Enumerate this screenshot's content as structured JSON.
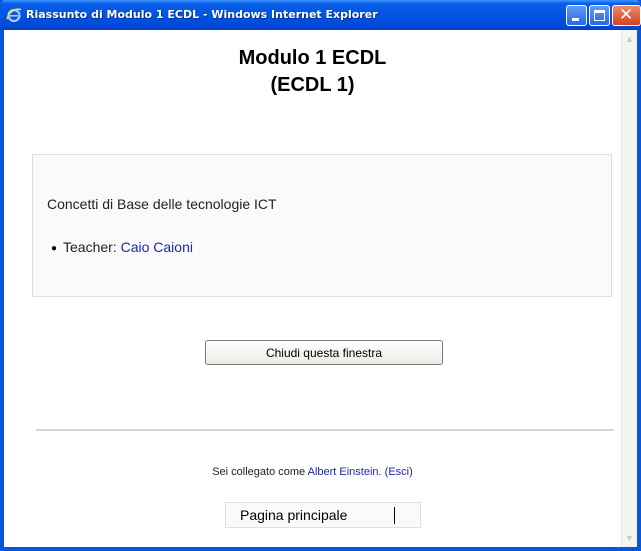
{
  "window": {
    "title": "Riassunto di Modulo 1 ECDL - Windows Internet Explorer",
    "accent": "#0055e5",
    "close_color": "#d6401c"
  },
  "course": {
    "title_line1": "Modulo 1 ECDL",
    "title_line2": "(ECDL 1)",
    "summary": "Concetti di Base delle tecnologie ICT",
    "teacher_label": "Teacher: ",
    "teacher_name": "Caio Caioni"
  },
  "actions": {
    "close_window_label": "Chiudi questa finestra"
  },
  "footer": {
    "logged_in_prefix": "Sei collegato come ",
    "user_name": "Albert Einstein.",
    "logout_label": "(Esci)",
    "home_label": "Pagina principale"
  },
  "colors": {
    "link": "#1d24b5",
    "border": "#dddddd"
  },
  "icons": {
    "app": "ie-icon",
    "minimize": "minimize-icon",
    "maximize": "maximize-icon",
    "close": "close-icon"
  }
}
